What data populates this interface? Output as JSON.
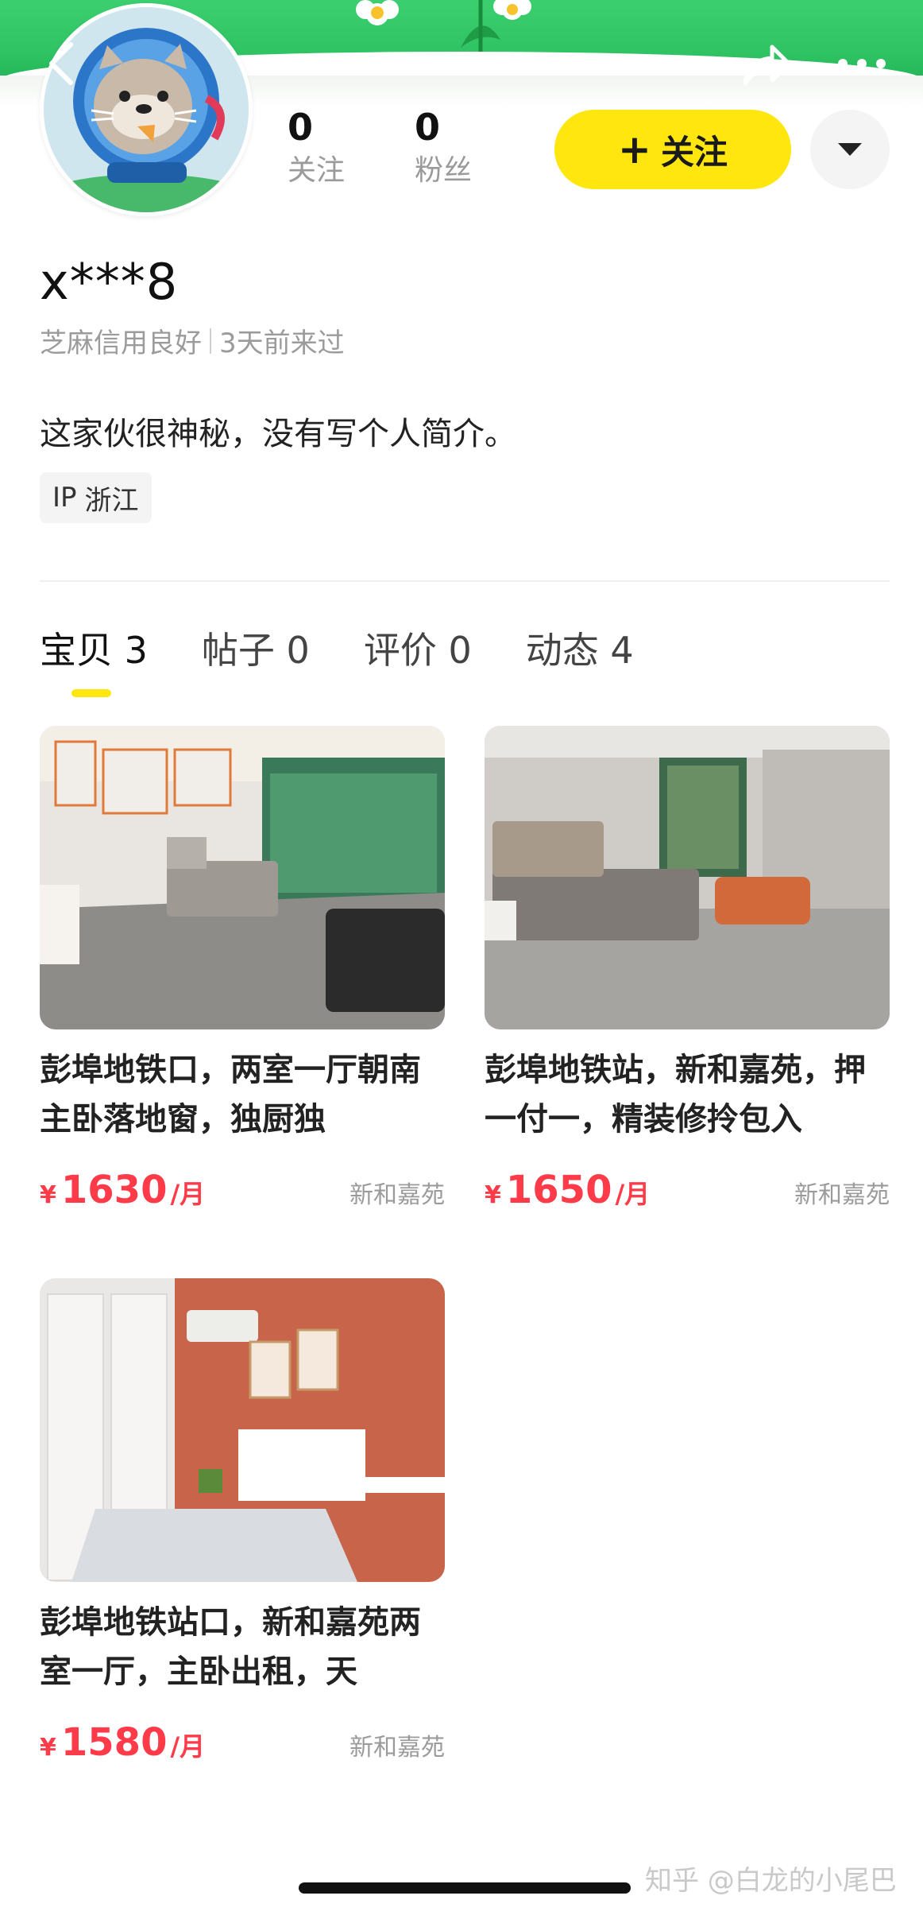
{
  "header": {
    "back_icon": "chevron-left-icon",
    "share_icon": "share-arrow-icon",
    "more_icon": "more-dots-icon",
    "banner_color": "#2fc363"
  },
  "profile": {
    "stats": [
      {
        "value": "0",
        "label": "关注"
      },
      {
        "value": "0",
        "label": "粉丝"
      }
    ],
    "follow_button": {
      "plus": "+",
      "label": "关注"
    },
    "username": "x***8",
    "credit": "芝麻信用良好",
    "last_seen": "3天前来过",
    "bio": "这家伙很神秘，没有写个人简介。",
    "ip_label": "IP",
    "ip_region": "浙江"
  },
  "tabs": [
    {
      "label": "宝贝",
      "count": "3",
      "active": true
    },
    {
      "label": "帖子",
      "count": "0"
    },
    {
      "label": "评价",
      "count": "0"
    },
    {
      "label": "动态",
      "count": "4"
    }
  ],
  "listings": [
    {
      "title": "彭埠地铁口，两室一厅朝南主卧落地窗，独厨独",
      "currency": "¥",
      "price": "1630",
      "unit": "/月",
      "community": "新和嘉苑"
    },
    {
      "title": "彭埠地铁站，新和嘉苑，押一付一，精装修拎包入",
      "currency": "¥",
      "price": "1650",
      "unit": "/月",
      "community": "新和嘉苑"
    },
    {
      "title": "彭埠地铁站口，新和嘉苑两室一厅，主卧出租，天",
      "currency": "¥",
      "price": "1580",
      "unit": "/月",
      "community": "新和嘉苑"
    }
  ],
  "watermark": "知乎 @白龙的小尾巴",
  "colors": {
    "accent_yellow": "#ffe60f",
    "price_red": "#ff3b4a"
  }
}
